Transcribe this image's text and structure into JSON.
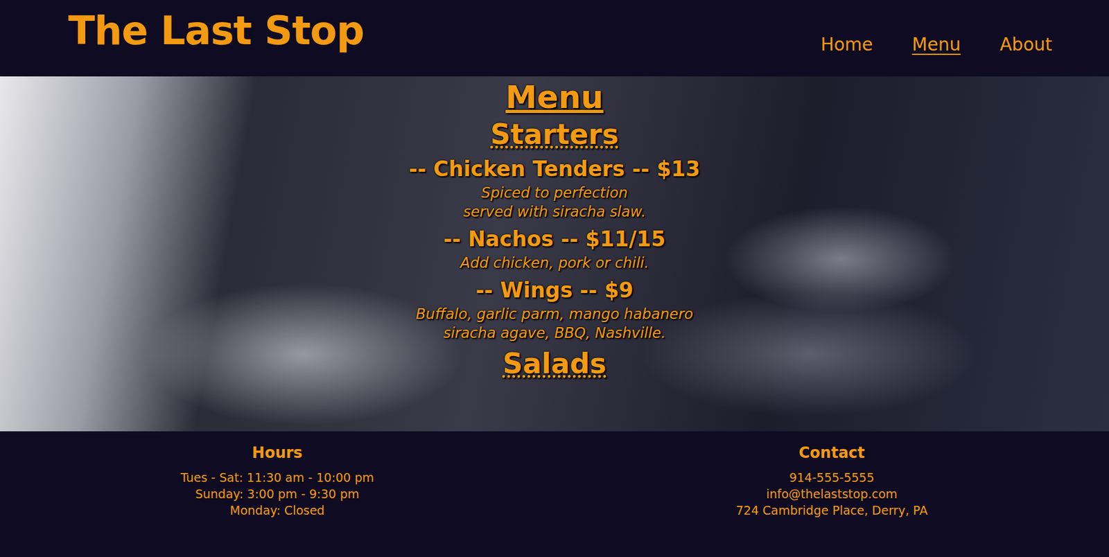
{
  "header": {
    "title": "The Last Stop"
  },
  "nav": [
    {
      "label": "Home",
      "selected": false
    },
    {
      "label": "Menu",
      "selected": true
    },
    {
      "label": "About",
      "selected": false
    }
  ],
  "menu": {
    "title": "Menu",
    "sections": [
      {
        "title": "Starters",
        "items": [
          {
            "name": "-- Chicken Tenders -- $13",
            "description": [
              "Spiced to perfection",
              "served with siracha slaw."
            ]
          },
          {
            "name": "-- Nachos -- $11/15",
            "description": [
              "Add chicken, pork or chili."
            ]
          },
          {
            "name": "-- Wings -- $9",
            "description": [
              "Buffalo, garlic parm, mango habanero",
              "siracha agave, BBQ, Nashville."
            ]
          }
        ]
      },
      {
        "title": "Salads",
        "items": []
      }
    ]
  },
  "footer": {
    "hours": {
      "title": "Hours",
      "lines": [
        "Tues - Sat: 11:30 am - 10:00 pm",
        "Sunday: 3:00 pm - 9:30 pm",
        "Monday: Closed"
      ]
    },
    "contact": {
      "title": "Contact",
      "lines": [
        "914-555-5555",
        "info@thelaststop.com",
        "724 Cambridge Place, Derry, PA"
      ]
    }
  }
}
